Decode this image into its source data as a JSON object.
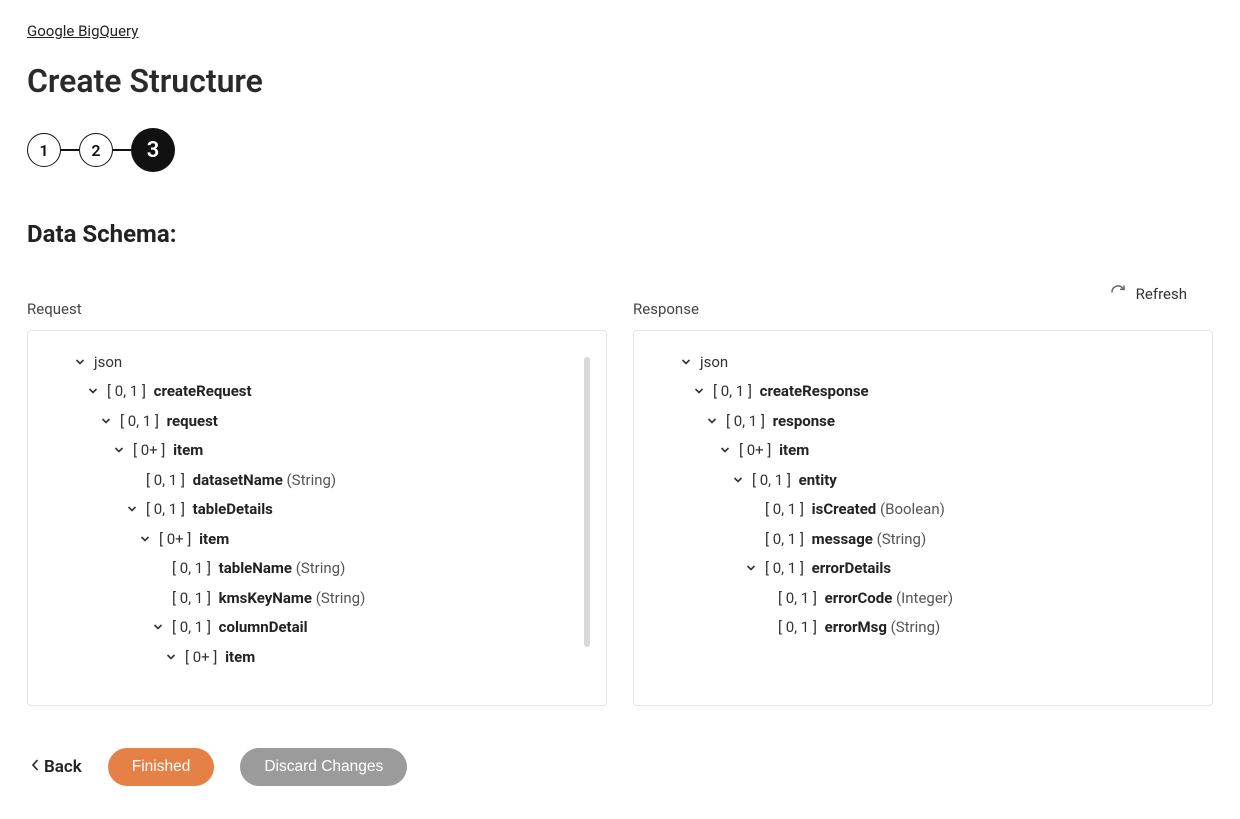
{
  "breadcrumb": "Google BigQuery",
  "page_title": "Create Structure",
  "steps": [
    "1",
    "2",
    "3"
  ],
  "section_title": "Data Schema:",
  "refresh_label": "Refresh",
  "request_label": "Request",
  "response_label": "Response",
  "back_label": "Back",
  "finished_label": "Finished",
  "discard_label": "Discard Changes",
  "request_tree": [
    {
      "indent": 0,
      "chev": true,
      "root": true,
      "label": "json"
    },
    {
      "indent": 1,
      "chev": true,
      "card": "[ 0, 1 ]",
      "name": "createRequest"
    },
    {
      "indent": 2,
      "chev": true,
      "card": "[ 0, 1 ]",
      "name": "request"
    },
    {
      "indent": 3,
      "chev": true,
      "card": "[ 0+ ]",
      "name": "item"
    },
    {
      "indent": 4,
      "chev": false,
      "card": "[ 0, 1 ]",
      "name": "datasetName",
      "type": "(String)"
    },
    {
      "indent": 4,
      "chev": true,
      "card": "[ 0, 1 ]",
      "name": "tableDetails"
    },
    {
      "indent": 5,
      "chev": true,
      "card": "[ 0+ ]",
      "name": "item"
    },
    {
      "indent": 6,
      "chev": false,
      "card": "[ 0, 1 ]",
      "name": "tableName",
      "type": "(String)"
    },
    {
      "indent": 6,
      "chev": false,
      "card": "[ 0, 1 ]",
      "name": "kmsKeyName",
      "type": "(String)"
    },
    {
      "indent": 6,
      "chev": true,
      "card": "[ 0, 1 ]",
      "name": "columnDetail"
    },
    {
      "indent": 7,
      "chev": true,
      "card": "[ 0+ ]",
      "name": "item"
    }
  ],
  "response_tree": [
    {
      "indent": 0,
      "chev": true,
      "root": true,
      "label": "json"
    },
    {
      "indent": 1,
      "chev": true,
      "card": "[ 0, 1 ]",
      "name": "createResponse"
    },
    {
      "indent": 2,
      "chev": true,
      "card": "[ 0, 1 ]",
      "name": "response"
    },
    {
      "indent": 3,
      "chev": true,
      "card": "[ 0+ ]",
      "name": "item"
    },
    {
      "indent": 4,
      "chev": true,
      "card": "[ 0, 1 ]",
      "name": "entity"
    },
    {
      "indent": 5,
      "chev": false,
      "card": "[ 0, 1 ]",
      "name": "isCreated",
      "type": "(Boolean)"
    },
    {
      "indent": 5,
      "chev": false,
      "card": "[ 0, 1 ]",
      "name": "message",
      "type": "(String)"
    },
    {
      "indent": 5,
      "chev": true,
      "card": "[ 0, 1 ]",
      "name": "errorDetails"
    },
    {
      "indent": 6,
      "chev": false,
      "card": "[ 0, 1 ]",
      "name": "errorCode",
      "type": "(Integer)"
    },
    {
      "indent": 6,
      "chev": false,
      "card": "[ 0, 1 ]",
      "name": "errorMsg",
      "type": "(String)"
    }
  ]
}
